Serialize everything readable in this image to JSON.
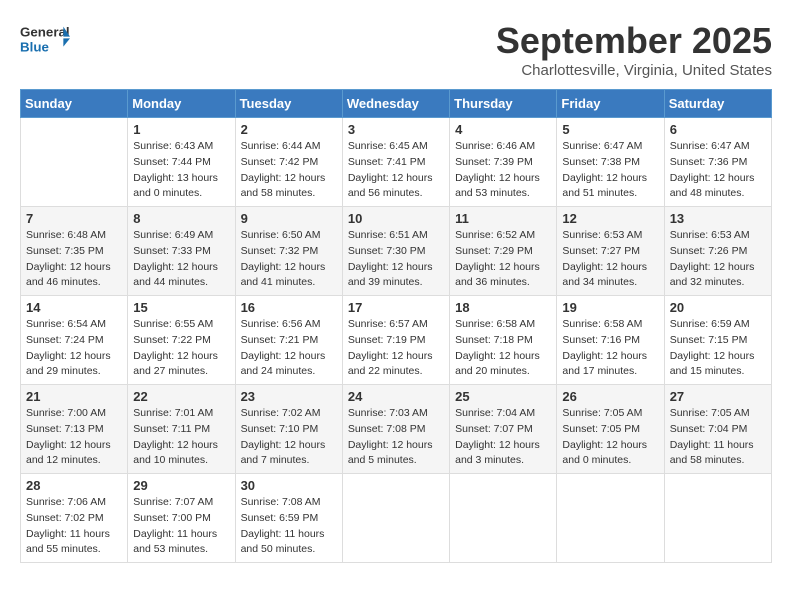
{
  "header": {
    "logo_line1": "General",
    "logo_line2": "Blue",
    "month": "September 2025",
    "location": "Charlottesville, Virginia, United States"
  },
  "days_of_week": [
    "Sunday",
    "Monday",
    "Tuesday",
    "Wednesday",
    "Thursday",
    "Friday",
    "Saturday"
  ],
  "weeks": [
    [
      {
        "day": "",
        "info": ""
      },
      {
        "day": "1",
        "info": "Sunrise: 6:43 AM\nSunset: 7:44 PM\nDaylight: 13 hours\nand 0 minutes."
      },
      {
        "day": "2",
        "info": "Sunrise: 6:44 AM\nSunset: 7:42 PM\nDaylight: 12 hours\nand 58 minutes."
      },
      {
        "day": "3",
        "info": "Sunrise: 6:45 AM\nSunset: 7:41 PM\nDaylight: 12 hours\nand 56 minutes."
      },
      {
        "day": "4",
        "info": "Sunrise: 6:46 AM\nSunset: 7:39 PM\nDaylight: 12 hours\nand 53 minutes."
      },
      {
        "day": "5",
        "info": "Sunrise: 6:47 AM\nSunset: 7:38 PM\nDaylight: 12 hours\nand 51 minutes."
      },
      {
        "day": "6",
        "info": "Sunrise: 6:47 AM\nSunset: 7:36 PM\nDaylight: 12 hours\nand 48 minutes."
      }
    ],
    [
      {
        "day": "7",
        "info": "Sunrise: 6:48 AM\nSunset: 7:35 PM\nDaylight: 12 hours\nand 46 minutes."
      },
      {
        "day": "8",
        "info": "Sunrise: 6:49 AM\nSunset: 7:33 PM\nDaylight: 12 hours\nand 44 minutes."
      },
      {
        "day": "9",
        "info": "Sunrise: 6:50 AM\nSunset: 7:32 PM\nDaylight: 12 hours\nand 41 minutes."
      },
      {
        "day": "10",
        "info": "Sunrise: 6:51 AM\nSunset: 7:30 PM\nDaylight: 12 hours\nand 39 minutes."
      },
      {
        "day": "11",
        "info": "Sunrise: 6:52 AM\nSunset: 7:29 PM\nDaylight: 12 hours\nand 36 minutes."
      },
      {
        "day": "12",
        "info": "Sunrise: 6:53 AM\nSunset: 7:27 PM\nDaylight: 12 hours\nand 34 minutes."
      },
      {
        "day": "13",
        "info": "Sunrise: 6:53 AM\nSunset: 7:26 PM\nDaylight: 12 hours\nand 32 minutes."
      }
    ],
    [
      {
        "day": "14",
        "info": "Sunrise: 6:54 AM\nSunset: 7:24 PM\nDaylight: 12 hours\nand 29 minutes."
      },
      {
        "day": "15",
        "info": "Sunrise: 6:55 AM\nSunset: 7:22 PM\nDaylight: 12 hours\nand 27 minutes."
      },
      {
        "day": "16",
        "info": "Sunrise: 6:56 AM\nSunset: 7:21 PM\nDaylight: 12 hours\nand 24 minutes."
      },
      {
        "day": "17",
        "info": "Sunrise: 6:57 AM\nSunset: 7:19 PM\nDaylight: 12 hours\nand 22 minutes."
      },
      {
        "day": "18",
        "info": "Sunrise: 6:58 AM\nSunset: 7:18 PM\nDaylight: 12 hours\nand 20 minutes."
      },
      {
        "day": "19",
        "info": "Sunrise: 6:58 AM\nSunset: 7:16 PM\nDaylight: 12 hours\nand 17 minutes."
      },
      {
        "day": "20",
        "info": "Sunrise: 6:59 AM\nSunset: 7:15 PM\nDaylight: 12 hours\nand 15 minutes."
      }
    ],
    [
      {
        "day": "21",
        "info": "Sunrise: 7:00 AM\nSunset: 7:13 PM\nDaylight: 12 hours\nand 12 minutes."
      },
      {
        "day": "22",
        "info": "Sunrise: 7:01 AM\nSunset: 7:11 PM\nDaylight: 12 hours\nand 10 minutes."
      },
      {
        "day": "23",
        "info": "Sunrise: 7:02 AM\nSunset: 7:10 PM\nDaylight: 12 hours\nand 7 minutes."
      },
      {
        "day": "24",
        "info": "Sunrise: 7:03 AM\nSunset: 7:08 PM\nDaylight: 12 hours\nand 5 minutes."
      },
      {
        "day": "25",
        "info": "Sunrise: 7:04 AM\nSunset: 7:07 PM\nDaylight: 12 hours\nand 3 minutes."
      },
      {
        "day": "26",
        "info": "Sunrise: 7:05 AM\nSunset: 7:05 PM\nDaylight: 12 hours\nand 0 minutes."
      },
      {
        "day": "27",
        "info": "Sunrise: 7:05 AM\nSunset: 7:04 PM\nDaylight: 11 hours\nand 58 minutes."
      }
    ],
    [
      {
        "day": "28",
        "info": "Sunrise: 7:06 AM\nSunset: 7:02 PM\nDaylight: 11 hours\nand 55 minutes."
      },
      {
        "day": "29",
        "info": "Sunrise: 7:07 AM\nSunset: 7:00 PM\nDaylight: 11 hours\nand 53 minutes."
      },
      {
        "day": "30",
        "info": "Sunrise: 7:08 AM\nSunset: 6:59 PM\nDaylight: 11 hours\nand 50 minutes."
      },
      {
        "day": "",
        "info": ""
      },
      {
        "day": "",
        "info": ""
      },
      {
        "day": "",
        "info": ""
      },
      {
        "day": "",
        "info": ""
      }
    ]
  ]
}
